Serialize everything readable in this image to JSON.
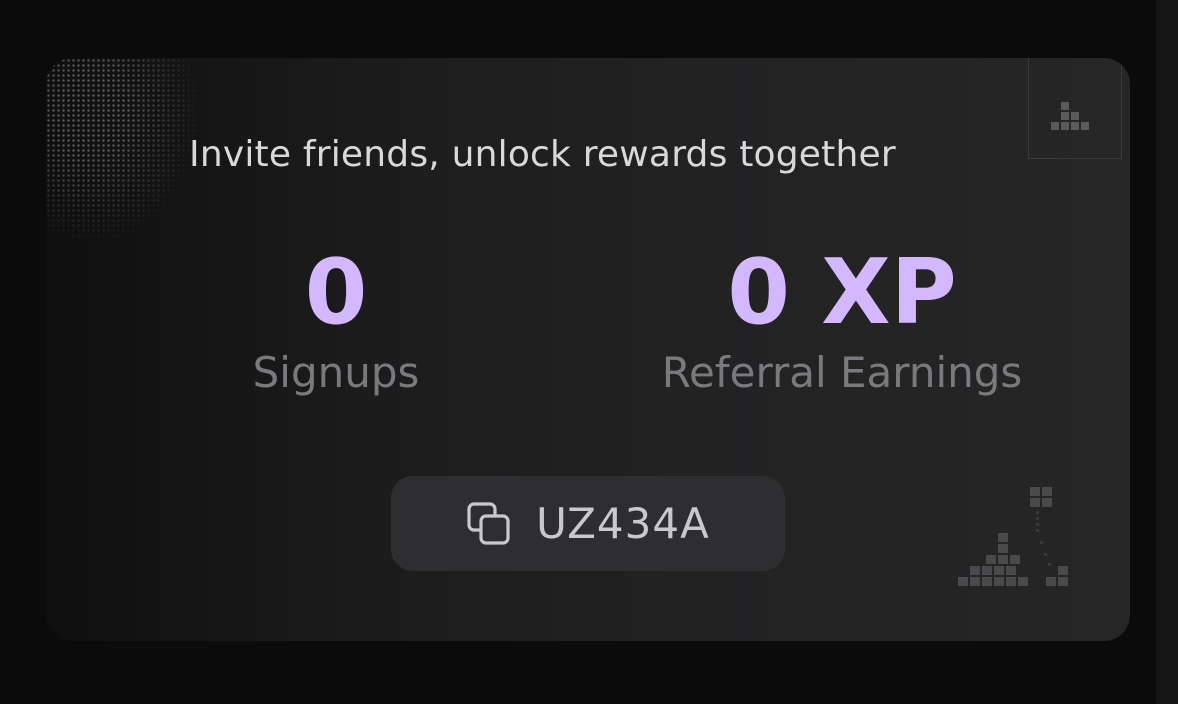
{
  "referral": {
    "headline": "Invite friends, unlock rewards together",
    "signups_value": "0",
    "signups_label": "Signups",
    "earnings_value": "0 XP",
    "earnings_label": "Referral Earnings",
    "referral_code": "UZ434A"
  },
  "colors": {
    "accent": "#d4b8ff",
    "label": "#7a7a7e",
    "card_bg": "#222223",
    "button_bg": "#2e2e30"
  },
  "icons": {
    "copy": "copy-icon",
    "corner": "pixel-blocks-icon",
    "decoration": "pixel-bars-icon"
  }
}
